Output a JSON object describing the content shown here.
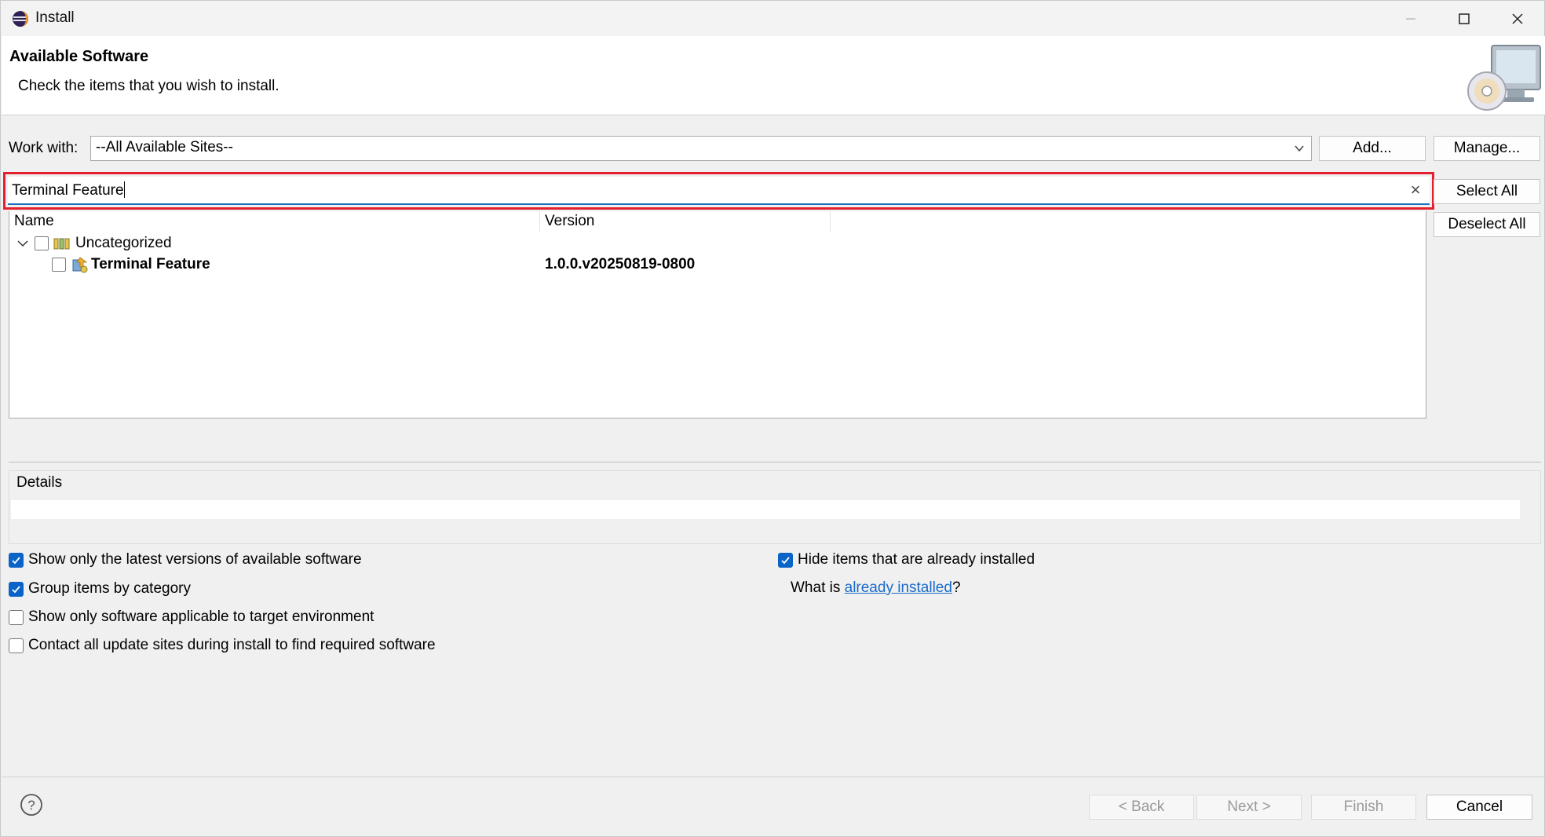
{
  "window": {
    "title": "Install"
  },
  "banner": {
    "title": "Available Software",
    "description": "Check the items that you wish to install."
  },
  "work_with": {
    "label": "Work with:",
    "selected_site": "--All Available Sites--",
    "add_label": "Add...",
    "manage_label": "Manage..."
  },
  "filter": {
    "value": "Terminal Feature",
    "clear_glyph": "×"
  },
  "selection_buttons": {
    "select_all": "Select All",
    "deselect_all": "Deselect All"
  },
  "tree": {
    "columns": [
      "Name",
      "Version"
    ],
    "rows": [
      {
        "name": "Uncategorized",
        "version": "",
        "expanded": true,
        "checked": false,
        "icon": "category-icon"
      },
      {
        "name": "Terminal Feature",
        "version": "1.0.0.v20250819-0800",
        "checked": false,
        "icon": "feature-icon"
      }
    ]
  },
  "details": {
    "label": "Details"
  },
  "options": {
    "latest_versions": {
      "label": "Show only the latest versions of available software",
      "checked": true
    },
    "group_by_category": {
      "label": "Group items by category",
      "checked": true
    },
    "target_environment": {
      "label": "Show only software applicable to target environment",
      "checked": false
    },
    "contact_all_sites": {
      "label": "Contact all update sites during install to find required software",
      "checked": false
    },
    "hide_installed": {
      "label": "Hide items that are already installed",
      "checked": true
    }
  },
  "already_installed": {
    "prefix": "What is ",
    "link": "already installed",
    "suffix": "?"
  },
  "footer": {
    "back": "< Back",
    "next": "Next >",
    "finish": "Finish",
    "cancel": "Cancel"
  },
  "colors": {
    "accent": "#0a64c8",
    "highlight_border": "#e3202f",
    "link": "#1b6ac9"
  }
}
